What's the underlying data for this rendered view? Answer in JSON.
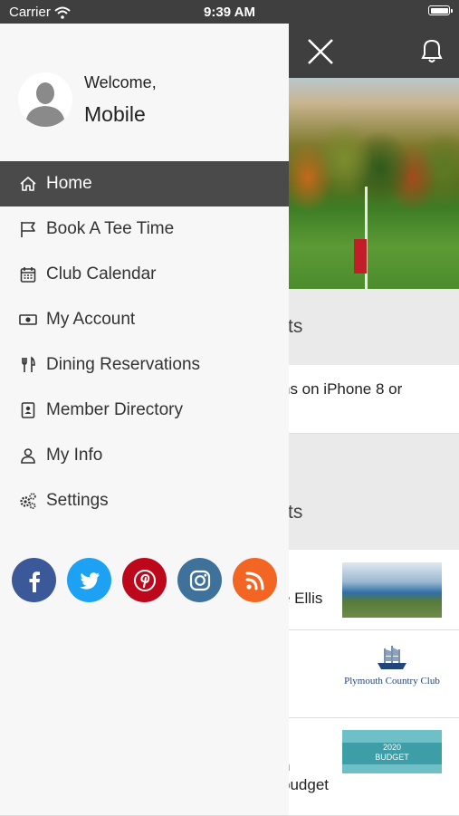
{
  "status_bar": {
    "carrier": "Carrier",
    "time": "9:39 AM"
  },
  "profile": {
    "greeting": "Welcome,",
    "name": "Mobile"
  },
  "menu": {
    "items": [
      {
        "label": "Home",
        "icon": "home-icon",
        "active": true
      },
      {
        "label": "Book A Tee Time",
        "icon": "flag-icon"
      },
      {
        "label": "Club Calendar",
        "icon": "calendar-icon"
      },
      {
        "label": "My Account",
        "icon": "cash-icon"
      },
      {
        "label": "Dining Reservations",
        "icon": "utensils-icon"
      },
      {
        "label": "Member Directory",
        "icon": "contact-book-icon"
      },
      {
        "label": "My Info",
        "icon": "user-icon"
      },
      {
        "label": "Settings",
        "icon": "gears-icon"
      }
    ]
  },
  "social": {
    "items": [
      {
        "name": "facebook-icon",
        "color": "#3b5998"
      },
      {
        "name": "twitter-icon",
        "color": "#1da1f2"
      },
      {
        "name": "pinterest-icon",
        "color": "#bd081c"
      },
      {
        "name": "instagram-icon",
        "color": "#3f729b"
      },
      {
        "name": "rss-icon",
        "color": "#f26522"
      }
    ]
  },
  "background_content": {
    "section1_fragment": "ts",
    "row1_fragment": "ns on iPhone 8 or",
    "section2_fragment": "ts",
    "row2_fragment": "e Ellis",
    "logo_text": "Plymouth Country Club",
    "row3_line1": "n",
    "row3_line2": "budget",
    "budget_thumb_line1": "2020",
    "budget_thumb_line2": "BUDGET"
  },
  "colors": {
    "header": "#3f3f3f",
    "drawer": "#f7f7f7",
    "active_item": "#4a4a4a"
  }
}
